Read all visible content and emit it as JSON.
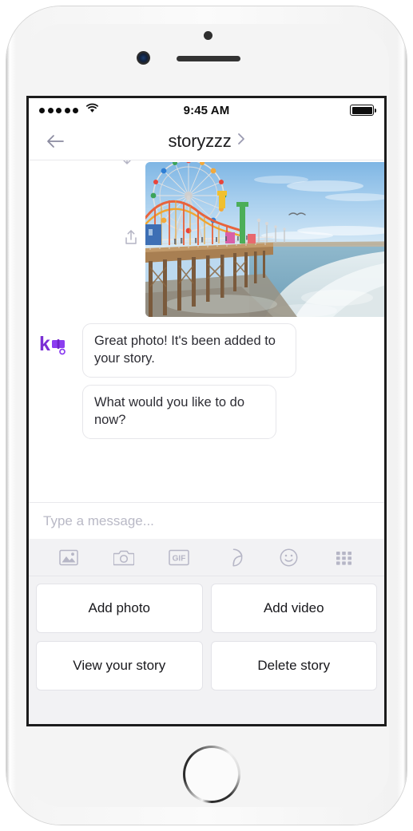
{
  "status_bar": {
    "time": "9:45 AM",
    "signal_dots": 5,
    "wifi_icon": "wifi-icon",
    "battery_icon": "battery-full-icon"
  },
  "nav": {
    "back_icon": "back-arrow-icon",
    "title": "storyzzz",
    "chevron_icon": "chevron-right-icon"
  },
  "chat": {
    "photo_message": {
      "alt": "Santa Monica Pier with ferris wheel and roller coaster beside ocean waves",
      "reply_icon": "reply-icon",
      "share_icon": "share-upload-icon"
    },
    "bot_avatar_icon": "kik-bot-avatar-icon",
    "messages": [
      {
        "text": "Great photo! It's been added to your story."
      },
      {
        "text": "What would you like to do now?"
      }
    ]
  },
  "input": {
    "placeholder": "Type a message...",
    "value": ""
  },
  "toolbar_icons": [
    {
      "name": "gallery-icon",
      "label": ""
    },
    {
      "name": "camera-icon",
      "label": ""
    },
    {
      "name": "gif-icon",
      "label": "GIF"
    },
    {
      "name": "sticker-icon",
      "label": ""
    },
    {
      "name": "emoji-icon",
      "label": ""
    },
    {
      "name": "apps-grid-icon",
      "label": ""
    }
  ],
  "actions": [
    {
      "label": "Add photo"
    },
    {
      "label": "Add video"
    },
    {
      "label": "View your story"
    },
    {
      "label": "Delete story"
    }
  ],
  "colors": {
    "brand_purple": "#7a2fd4",
    "toolbar_bg": "#f2f2f4",
    "icon_gray": "#b0b0c0",
    "text_dark": "#1d1d1f"
  }
}
